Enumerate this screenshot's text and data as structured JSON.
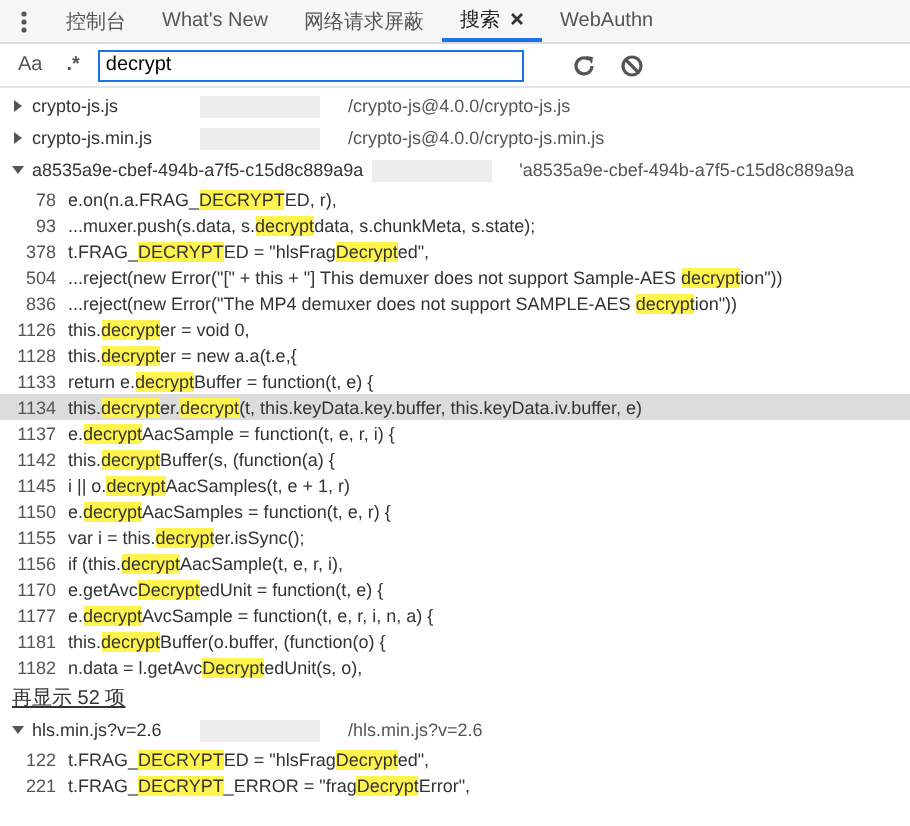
{
  "tabs": [
    {
      "label": "控制台",
      "selected": false,
      "closable": false
    },
    {
      "label": "What's New",
      "selected": false,
      "closable": false
    },
    {
      "label": "网络请求屏蔽",
      "selected": false,
      "closable": false
    },
    {
      "label": "搜索",
      "selected": true,
      "closable": true
    },
    {
      "label": "WebAuthn",
      "selected": false,
      "closable": false
    }
  ],
  "search": {
    "case_toggle": "Aa",
    "regex_toggle": ".*",
    "value": "decrypt"
  },
  "files": [
    {
      "name": "crypto-js.js",
      "path": "/crypto-js@4.0.0/crypto-js.js",
      "expanded": false
    },
    {
      "name": "crypto-js.min.js",
      "path": "/crypto-js@4.0.0/crypto-js.min.js",
      "expanded": false
    },
    {
      "name": "a8535a9e-cbef-494b-a7f5-c15d8c889a9a",
      "path": "'a8535a9e-cbef-494b-a7f5-c15d8c889a9a",
      "expanded": true,
      "more": "再显示 52 项",
      "matches": [
        {
          "line": "78",
          "selected": false,
          "segments": [
            {
              "text": "e.on(n.a.FRAG_",
              "match": false
            },
            {
              "text": "DECRYPT",
              "match": true
            },
            {
              "text": "ED, r),",
              "match": false
            }
          ]
        },
        {
          "line": "93",
          "selected": false,
          "segments": [
            {
              "text": "...muxer.push(s.data, s.",
              "match": false
            },
            {
              "text": "decrypt",
              "match": true
            },
            {
              "text": "data, s.chunkMeta, s.state);",
              "match": false
            }
          ]
        },
        {
          "line": "378",
          "selected": false,
          "segments": [
            {
              "text": "t.FRAG_",
              "match": false
            },
            {
              "text": "DECRYPT",
              "match": true
            },
            {
              "text": "ED = \"hlsFrag",
              "match": false
            },
            {
              "text": "Decrypt",
              "match": true
            },
            {
              "text": "ed\",",
              "match": false
            }
          ]
        },
        {
          "line": "504",
          "selected": false,
          "segments": [
            {
              "text": "...reject(new Error(\"[\" + this + \"] This demuxer does not support Sample-AES ",
              "match": false
            },
            {
              "text": "decrypt",
              "match": true
            },
            {
              "text": "ion\"))",
              "match": false
            }
          ]
        },
        {
          "line": "836",
          "selected": false,
          "segments": [
            {
              "text": "...reject(new Error(\"The MP4 demuxer does not support SAMPLE-AES ",
              "match": false
            },
            {
              "text": "decrypt",
              "match": true
            },
            {
              "text": "ion\"))",
              "match": false
            }
          ]
        },
        {
          "line": "1126",
          "selected": false,
          "segments": [
            {
              "text": "this.",
              "match": false
            },
            {
              "text": "decrypt",
              "match": true
            },
            {
              "text": "er = void 0,",
              "match": false
            }
          ]
        },
        {
          "line": "1128",
          "selected": false,
          "segments": [
            {
              "text": "this.",
              "match": false
            },
            {
              "text": "decrypt",
              "match": true
            },
            {
              "text": "er = new a.a(t.e,{",
              "match": false
            }
          ]
        },
        {
          "line": "1133",
          "selected": false,
          "segments": [
            {
              "text": "return e.",
              "match": false
            },
            {
              "text": "decrypt",
              "match": true
            },
            {
              "text": "Buffer = function(t, e) {",
              "match": false
            }
          ]
        },
        {
          "line": "1134",
          "selected": true,
          "segments": [
            {
              "text": "this.",
              "match": false
            },
            {
              "text": "decrypt",
              "match": true
            },
            {
              "text": "er.",
              "match": false
            },
            {
              "text": "decrypt",
              "match": true
            },
            {
              "text": "(t, this.keyData.key.buffer, this.keyData.iv.buffer, e)",
              "match": false
            }
          ]
        },
        {
          "line": "1137",
          "selected": false,
          "segments": [
            {
              "text": "e.",
              "match": false
            },
            {
              "text": "decrypt",
              "match": true
            },
            {
              "text": "AacSample = function(t, e, r, i) {",
              "match": false
            }
          ]
        },
        {
          "line": "1142",
          "selected": false,
          "segments": [
            {
              "text": "this.",
              "match": false
            },
            {
              "text": "decrypt",
              "match": true
            },
            {
              "text": "Buffer(s, (function(a) {",
              "match": false
            }
          ]
        },
        {
          "line": "1145",
          "selected": false,
          "segments": [
            {
              "text": "i || o.",
              "match": false
            },
            {
              "text": "decrypt",
              "match": true
            },
            {
              "text": "AacSamples(t, e + 1, r)",
              "match": false
            }
          ]
        },
        {
          "line": "1150",
          "selected": false,
          "segments": [
            {
              "text": "e.",
              "match": false
            },
            {
              "text": "decrypt",
              "match": true
            },
            {
              "text": "AacSamples = function(t, e, r) {",
              "match": false
            }
          ]
        },
        {
          "line": "1155",
          "selected": false,
          "segments": [
            {
              "text": "var i = this.",
              "match": false
            },
            {
              "text": "decrypt",
              "match": true
            },
            {
              "text": "er.isSync();",
              "match": false
            }
          ]
        },
        {
          "line": "1156",
          "selected": false,
          "segments": [
            {
              "text": "if (this.",
              "match": false
            },
            {
              "text": "decrypt",
              "match": true
            },
            {
              "text": "AacSample(t, e, r, i),",
              "match": false
            }
          ]
        },
        {
          "line": "1170",
          "selected": false,
          "segments": [
            {
              "text": "e.getAvc",
              "match": false
            },
            {
              "text": "Decrypt",
              "match": true
            },
            {
              "text": "edUnit = function(t, e) {",
              "match": false
            }
          ]
        },
        {
          "line": "1177",
          "selected": false,
          "segments": [
            {
              "text": "e.",
              "match": false
            },
            {
              "text": "decrypt",
              "match": true
            },
            {
              "text": "AvcSample = function(t, e, r, i, n, a) {",
              "match": false
            }
          ]
        },
        {
          "line": "1181",
          "selected": false,
          "segments": [
            {
              "text": "this.",
              "match": false
            },
            {
              "text": "decrypt",
              "match": true
            },
            {
              "text": "Buffer(o.buffer, (function(o) {",
              "match": false
            }
          ]
        },
        {
          "line": "1182",
          "selected": false,
          "segments": [
            {
              "text": "n.data = l.getAvc",
              "match": false
            },
            {
              "text": "Decrypt",
              "match": true
            },
            {
              "text": "edUnit(s, o),",
              "match": false
            }
          ]
        }
      ]
    },
    {
      "name": "hls.min.js?v=2.6",
      "path": "/hls.min.js?v=2.6",
      "expanded": true,
      "matches": [
        {
          "line": "122",
          "selected": false,
          "segments": [
            {
              "text": "t.FRAG_",
              "match": false
            },
            {
              "text": "DECRYPT",
              "match": true
            },
            {
              "text": "ED = \"hlsFrag",
              "match": false
            },
            {
              "text": "Decrypt",
              "match": true
            },
            {
              "text": "ed\",",
              "match": false
            }
          ]
        },
        {
          "line": "221",
          "selected": false,
          "segments": [
            {
              "text": "t.FRAG_",
              "match": false
            },
            {
              "text": "DECRYPT",
              "match": true
            },
            {
              "text": "_ERROR = \"frag",
              "match": false
            },
            {
              "text": "Decrypt",
              "match": true
            },
            {
              "text": "Error\",",
              "match": false
            }
          ]
        }
      ]
    }
  ]
}
